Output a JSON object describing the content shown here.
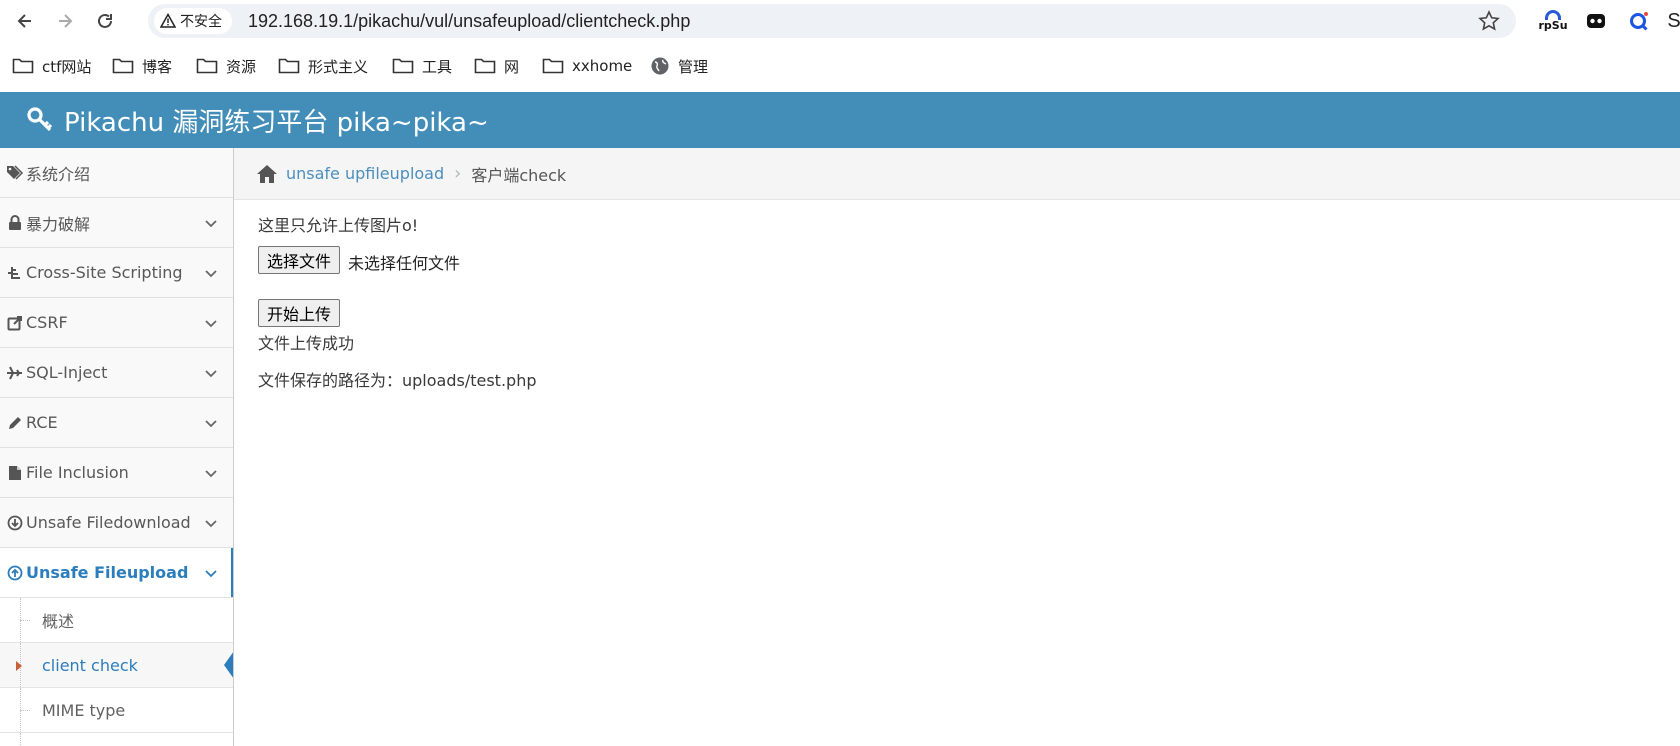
{
  "browser": {
    "security_label": "不安全",
    "url": "192.168.19.1/pikachu/vul/unsafeupload/clientcheck.php",
    "extensions": {
      "rpsu_label": "rpSu",
      "trailing_label": "S"
    }
  },
  "bookmarks": [
    {
      "label": "ctf网站",
      "icon": "folder-icon"
    },
    {
      "label": "博客",
      "icon": "folder-icon"
    },
    {
      "label": "资源",
      "icon": "folder-icon"
    },
    {
      "label": "形式主义",
      "icon": "folder-icon"
    },
    {
      "label": "工具",
      "icon": "folder-icon"
    },
    {
      "label": "网",
      "icon": "folder-icon"
    },
    {
      "label": "xxhome",
      "icon": "folder-icon"
    },
    {
      "label": "管理",
      "icon": "globe-icon"
    }
  ],
  "header": {
    "title": "Pikachu 漏洞练习平台 pika~pika~"
  },
  "sidebar": {
    "items": [
      {
        "label": "系统介绍",
        "icon": "tags-icon"
      },
      {
        "label": "暴力破解",
        "icon": "lock-icon"
      },
      {
        "label": "Cross-Site Scripting",
        "icon": "sitemap-icon"
      },
      {
        "label": "CSRF",
        "icon": "share-icon"
      },
      {
        "label": "SQL-Inject",
        "icon": "plane-icon"
      },
      {
        "label": "RCE",
        "icon": "pencil-icon"
      },
      {
        "label": "File Inclusion",
        "icon": "file-icon"
      },
      {
        "label": "Unsafe Filedownload",
        "icon": "download-circle-icon"
      },
      {
        "label": "Unsafe Fileupload",
        "icon": "upload-circle-icon"
      }
    ],
    "submenu": [
      {
        "label": "概述"
      },
      {
        "label": "client check"
      },
      {
        "label": "MIME type"
      }
    ]
  },
  "breadcrumb": {
    "parent": "unsafe upfileupload",
    "current": "客户端check"
  },
  "content": {
    "notice": "这里只允许上传图片o!",
    "choose_button": "选择文件",
    "no_file_text": "未选择任何文件",
    "upload_button": "开始上传",
    "success_text": "文件上传成功",
    "path_text": "文件保存的路径为：uploads/test.php"
  },
  "colors": {
    "header_bg": "#438eb9",
    "accent": "#2b7dbc",
    "link": "#4c8fbd"
  }
}
